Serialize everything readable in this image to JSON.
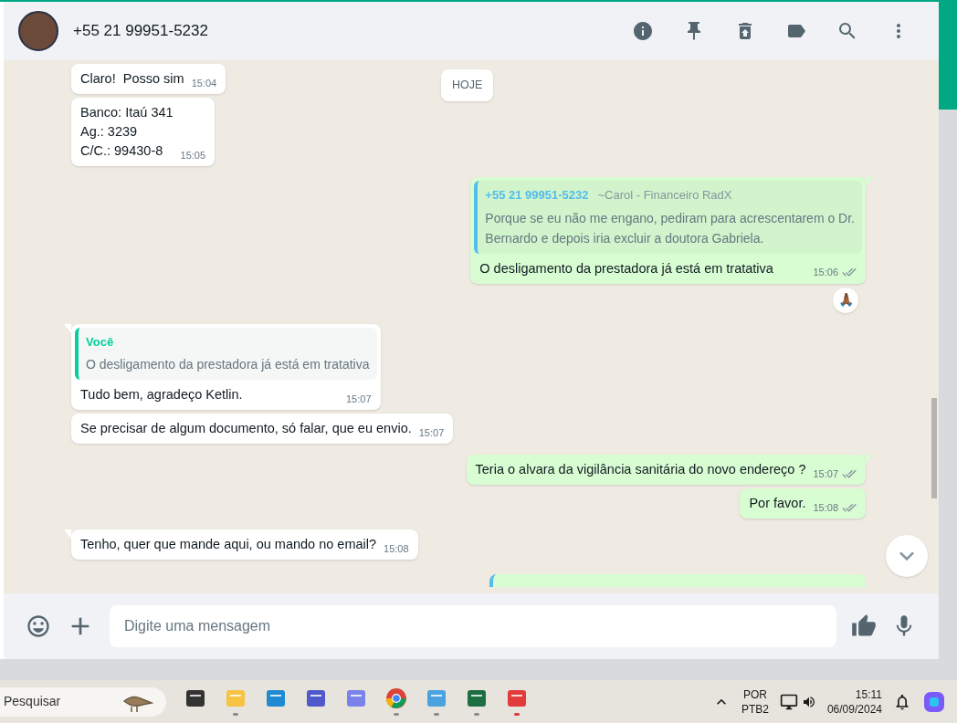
{
  "header": {
    "contact": "+55 21 99951-5232"
  },
  "date_chip": "HOJE",
  "messages": [
    {
      "kind": "in",
      "tail": false,
      "lines": [
        "Claro!  Posso sim"
      ],
      "time": "15:04"
    },
    {
      "kind": "in",
      "tail": false,
      "lines": [
        "Banco: Itaú 341",
        "Ag.: 3239",
        "C/C.: 99430-8"
      ],
      "time": "15:05"
    },
    {
      "kind": "out",
      "tail": true,
      "quote": {
        "author": "+55 21 99951-5232",
        "note": "~Carol - Financeiro RadX",
        "lines": [
          "Porque se eu não me engano, pediram para acrescentarem o Dr.",
          "Bernardo e depois iria excluir a doutora Gabriela."
        ],
        "color": "#53bdeb"
      },
      "lines": [
        "O desligamento da prestadora já está em tratativa"
      ],
      "time": "15:06",
      "delivered": true,
      "reaction": "🙏🏾"
    },
    {
      "kind": "in",
      "tail": true,
      "quote": {
        "author": "Você",
        "lines": [
          "O desligamento da prestadora já está em tratativa"
        ],
        "color": "#06cf9c"
      },
      "lines": [
        "Tudo bem, agradeço Ketlin."
      ],
      "time": "15:07"
    },
    {
      "kind": "in",
      "tail": false,
      "lines": [
        "Se precisar de algum documento, só falar, que eu envio."
      ],
      "time": "15:07"
    },
    {
      "kind": "out",
      "tail": true,
      "lines": [
        "Teria o alvara da vigilância sanitária do novo endereço ?"
      ],
      "time": "15:07",
      "delivered": true
    },
    {
      "kind": "out",
      "tail": false,
      "lines": [
        "Por favor."
      ],
      "time": "15:08",
      "delivered": true
    },
    {
      "kind": "in",
      "tail": true,
      "lines": [
        "Tenho, quer que mande aqui, ou mando no email?"
      ],
      "time": "15:08"
    },
    {
      "kind": "out_cut"
    }
  ],
  "composer": {
    "placeholder": "Digite uma mensagem"
  },
  "taskbar": {
    "search": "Pesquisar",
    "apps": [
      {
        "kind": "taskview",
        "running": false
      },
      {
        "kind": "folder",
        "running": true,
        "alert": false
      },
      {
        "kind": "edge",
        "running": false
      },
      {
        "kind": "teams",
        "running": false
      },
      {
        "kind": "teams2",
        "running": false
      },
      {
        "kind": "chrome",
        "running": true,
        "alert": false
      },
      {
        "kind": "notepad",
        "running": true,
        "alert": false
      },
      {
        "kind": "excel",
        "running": true,
        "alert": false
      },
      {
        "kind": "snip",
        "running": true,
        "alert": true
      }
    ],
    "lang": "POR",
    "layout": "PTB2",
    "time": "15:11",
    "date": "06/09/2024"
  }
}
